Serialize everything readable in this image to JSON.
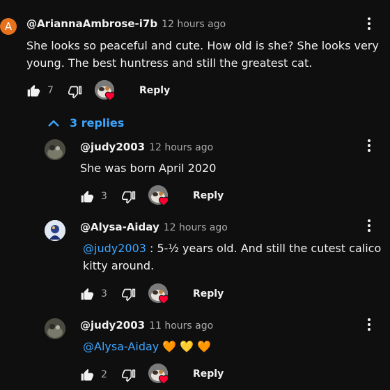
{
  "comment": {
    "avatar_letter": "A",
    "author": "@AriannaAmbrose-i7b",
    "time": "12 hours ago",
    "text_line1": "She looks so peaceful and cute. How old is she? She looks very",
    "text_line2": "young. The best huntress and still the greatest cat.",
    "likes": "7",
    "reply_label": "Reply"
  },
  "replies_toggle": "3 replies",
  "replies": [
    {
      "author": "@judy2003",
      "time": "12 hours ago",
      "text": "She was born April 2020",
      "likes": "3",
      "reply_label": "Reply"
    },
    {
      "author": "@Alysa-Aiday",
      "time": "12 hours ago",
      "mention": "@judy2003",
      "text_after_mention": " : 5-½ years old. And still the cutest calico",
      "text_line2": "kitty around.",
      "likes": "3",
      "reply_label": "Reply"
    },
    {
      "author": "@judy2003",
      "time": "11 hours ago",
      "mention": "@Alysa-Aiday",
      "emojis": "🧡 💛 🧡",
      "likes": "2",
      "reply_label": "Reply"
    }
  ],
  "colors": {
    "background": "#0f0f0f",
    "link": "#3ea6ff",
    "secondary_text": "#aaaaaa",
    "avatar_letter_bg": "#e8711c",
    "heart": "#ff0033"
  }
}
